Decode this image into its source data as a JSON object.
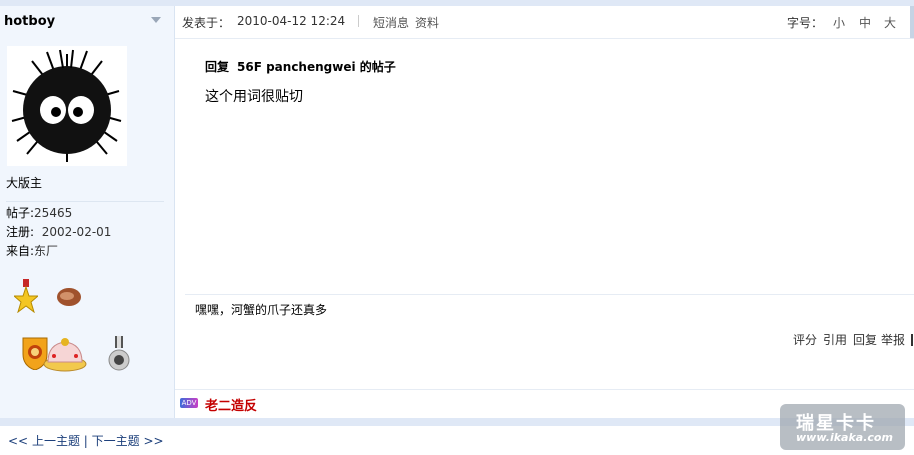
{
  "user": {
    "name": "hotboy",
    "group": "大版主",
    "posts_label": "帖子:",
    "posts_value": "25465",
    "reg_label": "注册:",
    "reg_value": "2002-02-01",
    "from_label": "来自:",
    "from_value": "东厂"
  },
  "post": {
    "posted_label": "发表于：",
    "date": "2010-04-12 12:24",
    "pm_link": "短消息",
    "profile_link": "资料",
    "fontsize_label": "字号：",
    "font_small": "小",
    "font_medium": "中",
    "font_large": "大",
    "reply_prefix": "回复",
    "reply_target": "56F panchengwei",
    "reply_suffix": "的帖子",
    "body": "这个用词很贴切",
    "signature": "嘿嘿，河蟹的爪子还真多",
    "actions": {
      "rate": "评分",
      "quote": "引用",
      "reply": "回复",
      "report": "举报"
    },
    "ad_badge": "ADV",
    "ad_text": "老二造反"
  },
  "nav": {
    "prev_arrows": "<<",
    "prev": "上一主题",
    "divider": "|",
    "next": "下一主题",
    "next_arrows": ">>"
  },
  "watermark": {
    "title": "瑞星卡卡",
    "url": "www.ikaka.com"
  },
  "icons": [
    "dropdown-triangle-icon",
    "avatar-soot-sprite",
    "star-medal-icon",
    "bean-medal-icon",
    "lion-shield-medal-icon",
    "crown-medal-icon",
    "silver-medal-icon"
  ],
  "colors": {
    "band": "#dfe8f6",
    "sidebar": "#f1f6fd",
    "ad_red": "#c40000",
    "link": "#1b3e7a"
  }
}
